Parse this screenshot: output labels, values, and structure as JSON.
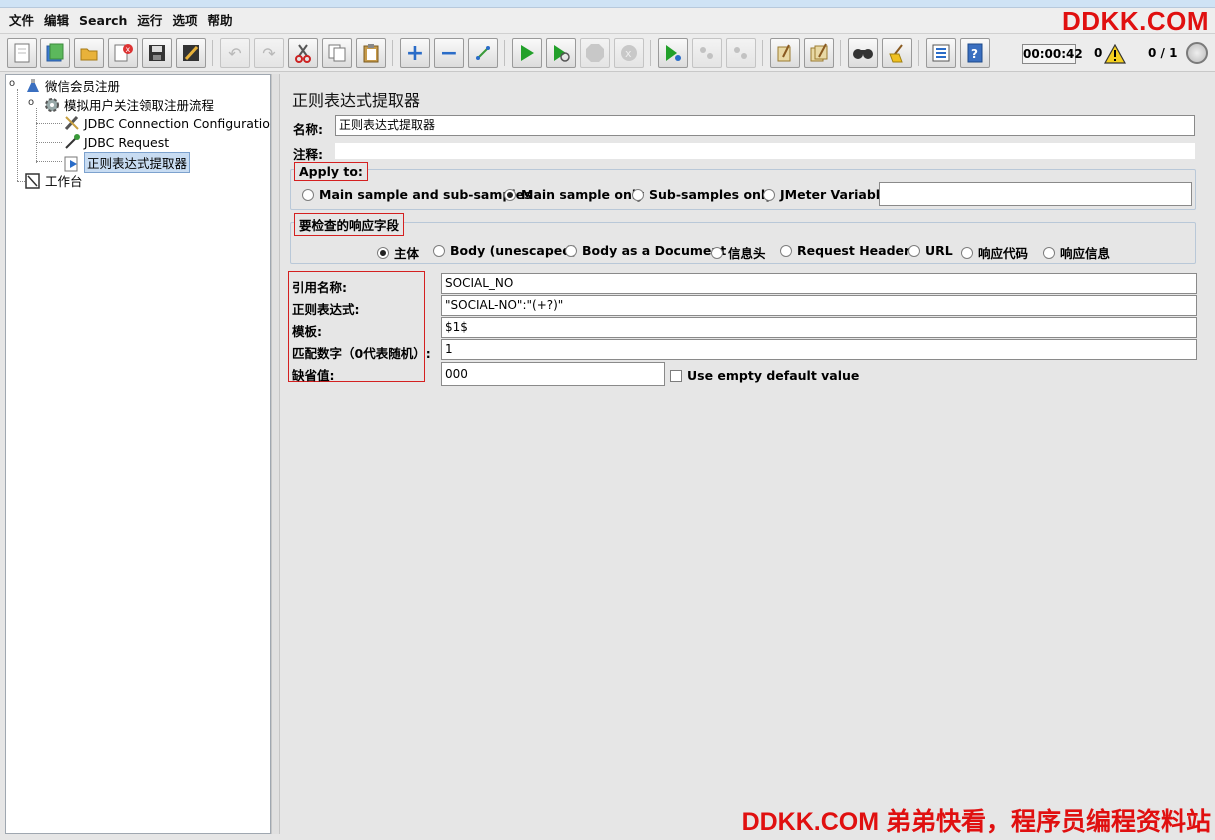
{
  "menu": [
    "文件",
    "编辑",
    "Search",
    "运行",
    "选项",
    "帮助"
  ],
  "watermark": {
    "top": "DDKK.COM",
    "bottom": "DDKK.COM 弟弟快看，程序员编程资料站"
  },
  "toolbar": {
    "icons": [
      "new-icon",
      "templates-icon",
      "open-icon",
      "close-icon",
      "save-icon",
      "save-as-icon",
      "undo-icon",
      "redo-icon",
      "cut-icon",
      "copy-icon",
      "paste-icon",
      "expand-icon",
      "collapse-icon",
      "toggle-icon",
      "start-icon",
      "start-no-pause-icon",
      "stop-icon",
      "shutdown-icon",
      "remote-start-icon",
      "remote-stop-icon",
      "remote-shutdown-icon",
      "clear-icon",
      "clear-all-icon",
      "search-icon",
      "reset-search-icon",
      "function-helper-icon",
      "help-icon"
    ],
    "timer": "00:00:42",
    "error_count": "0",
    "threads": "0 / 1"
  },
  "tree": {
    "root": "微信会员注册",
    "thread_group": "模拟用户关注领取注册流程",
    "jdbc_config": "JDBC Connection Configuration",
    "jdbc_request": "JDBC Request",
    "extractor": "正则表达式提取器",
    "workbench": "工作台"
  },
  "panel": {
    "title": "正则表达式提取器",
    "name_label": "名称:",
    "name_value": "正则表达式提取器",
    "comment_label": "注释:",
    "apply_to": {
      "legend": "Apply to:",
      "options": [
        "Main sample and sub-samples",
        "Main sample only",
        "Sub-samples only",
        "JMeter Variable"
      ],
      "selected": 1,
      "variable_value": ""
    },
    "response_field": {
      "legend": "要检查的响应字段",
      "options": [
        "主体",
        "Body (unescaped)",
        "Body as a Document",
        "信息头",
        "Request Headers",
        "URL",
        "响应代码",
        "响应信息"
      ],
      "selected": 0
    },
    "fields": {
      "ref_name_label": "引用名称:",
      "ref_name_value": "SOCIAL_NO",
      "regex_label": "正则表达式:",
      "regex_value": "\"SOCIAL-NO\":\"(+?)\"",
      "template_label": "模板:",
      "template_value": "$1$",
      "match_no_label": "匹配数字（0代表随机）:",
      "match_no_value": "1",
      "default_label": "缺省值:",
      "default_value": "000",
      "use_empty_label": "Use empty default value"
    }
  }
}
